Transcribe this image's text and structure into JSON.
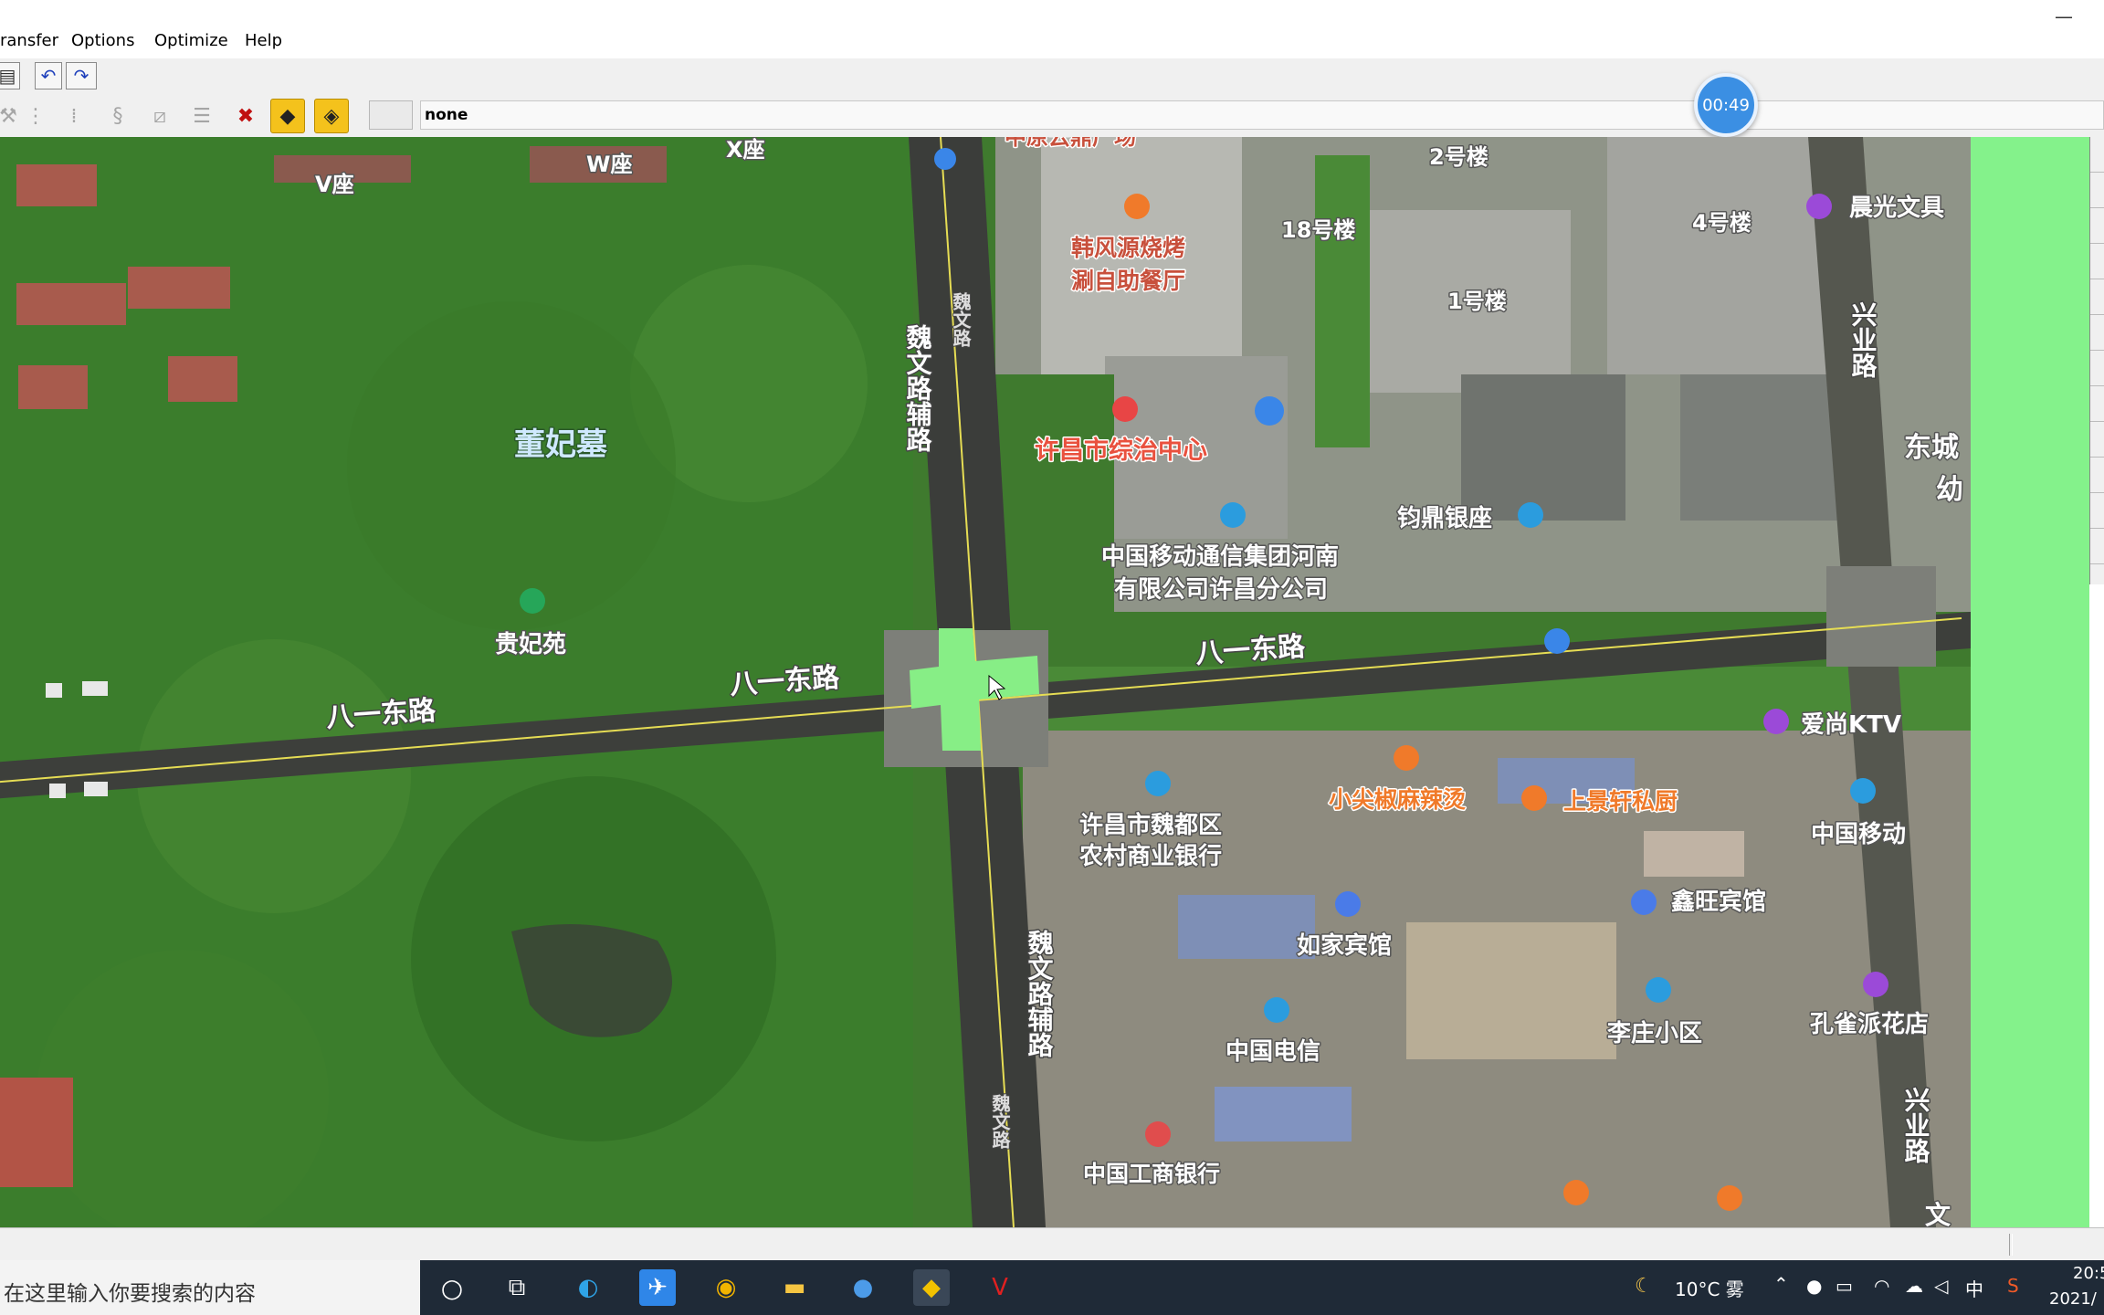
{
  "menu": {
    "items": [
      "ransfer",
      "Options",
      "Optimize",
      "Help"
    ]
  },
  "window": {
    "minimize_label": "—"
  },
  "toolbar": {
    "status_value": "none"
  },
  "timer": {
    "label": "00:49"
  },
  "map": {
    "labels": {
      "v_zuo": "V座",
      "w_zuo": "W座",
      "x_zuo": "X座",
      "zhongyuan_plaza": "中原云鼎广场",
      "hanfengyuan": "韩风源烧烤",
      "hanfengyuan_2": "涮自助餐厅",
      "bldg_2": "2号楼",
      "bldg_18": "18号楼",
      "bldg_4": "4号楼",
      "bldg_1": "1号楼",
      "chenguang": "晨光文具",
      "dongfei": "董妃墓",
      "weiwen_aux_n": "魏文路辅路",
      "weiwen_n": "魏文路",
      "xuchang_center": "许昌市综治中心",
      "xingye_n": "兴业路",
      "dongcheng": "东城",
      "you": "幼",
      "china_mobile_henan": "中国移动通信集团河南",
      "china_mobile_henan_2": "有限公司许昌分公司",
      "junding": "钧鼎银座",
      "guifei": "贵妃苑",
      "bayi_e_right": "八一东路",
      "bayi_e_mid": "八一东路",
      "bayi_e_left": "八一东路",
      "aishang": "爱尚KTV",
      "xiaojian": "小尖椒麻辣烫",
      "shangjing": "上景轩私厨",
      "rural_bank": "许昌市魏都区",
      "rural_bank_2": "农村商业银行",
      "china_mobile": "中国移动",
      "rujia": "如家宾馆",
      "xinwang": "鑫旺宾馆",
      "weiwen_aux_s": "魏文路辅路",
      "weiwen_s": "魏文路",
      "lizhuang": "李庄小区",
      "kongque": "孔雀派花店",
      "china_telecom": "中国电信",
      "xingye_s": "兴业路",
      "icbc": "中国工商银行",
      "wen": "文"
    }
  },
  "taskbar": {
    "search_placeholder": "在这里输入你要搜索的内容",
    "weather": "10°C 雾",
    "ime": "中",
    "time": "20:5",
    "date": "2021/"
  }
}
